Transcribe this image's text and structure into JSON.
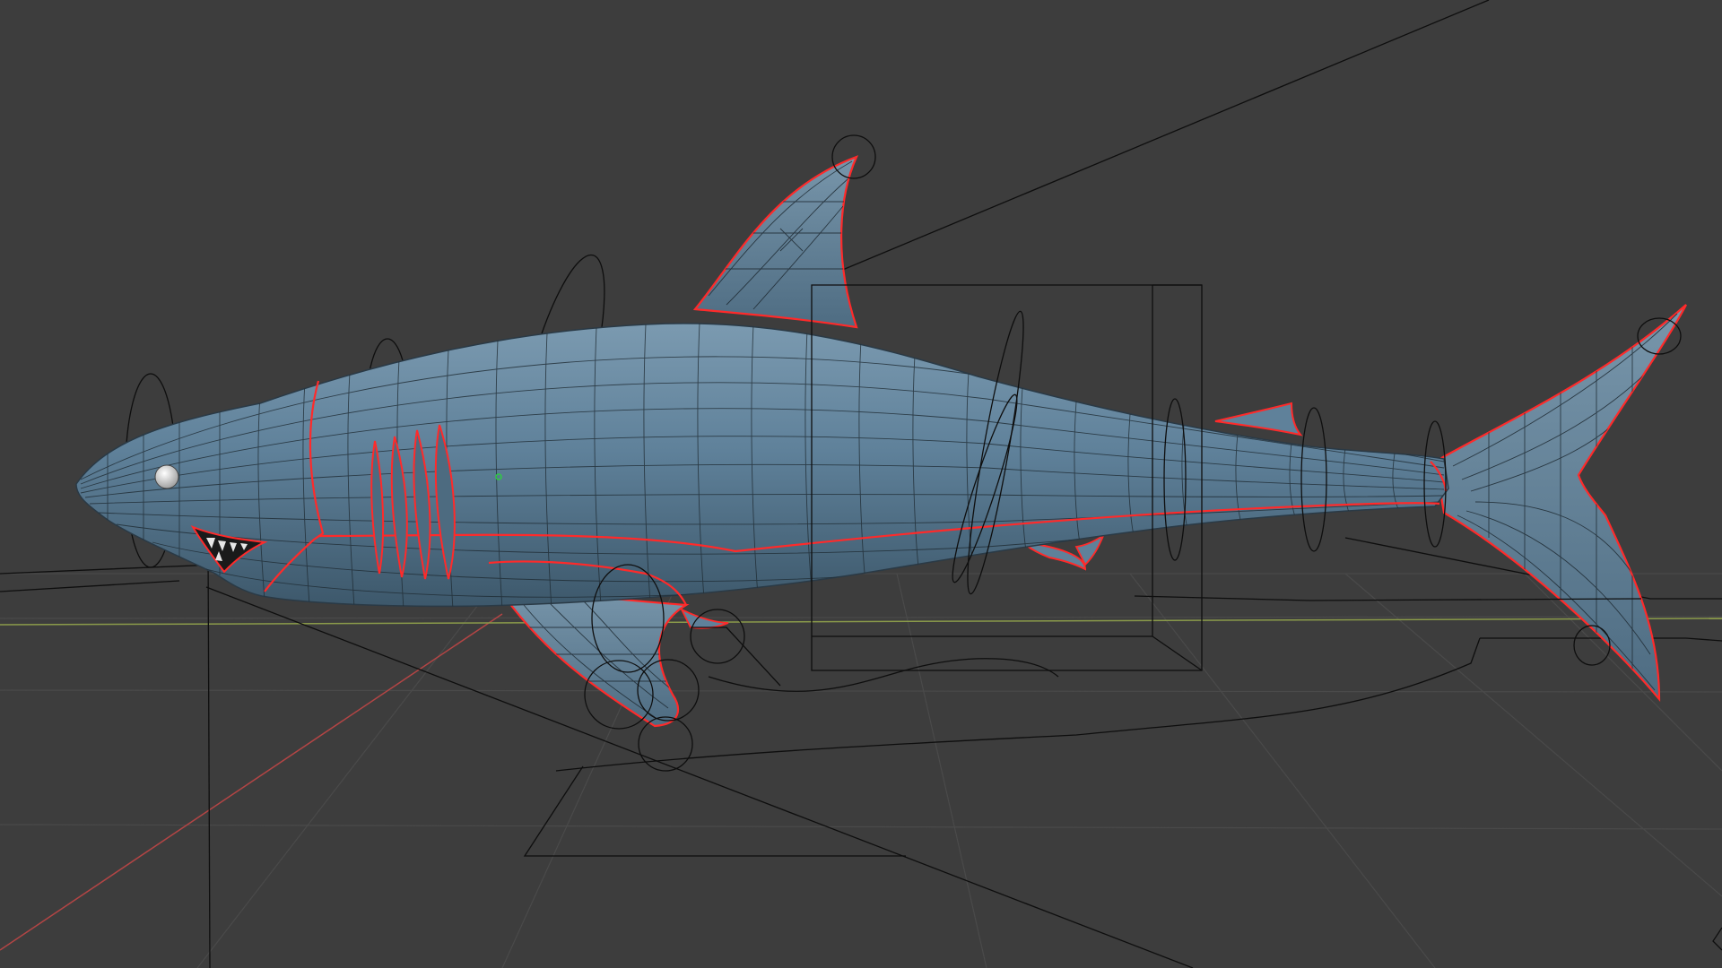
{
  "viewport": {
    "mode": "3d-viewport-wireframe-overlay",
    "background_color": "#3d3d3d",
    "grid_color": "#4a4a4a",
    "x_axis_color": "#b34545",
    "y_axis_color": "#8a9a4a",
    "rig_line_color": "#0e0e0e"
  },
  "model": {
    "object": "shark",
    "body_color": "#56788f",
    "wire_color": "#1f2b33",
    "seam_color": "#ff2a2a",
    "eye_color": "#d8d8d8",
    "origin_dot_color": "#2ecc40"
  }
}
